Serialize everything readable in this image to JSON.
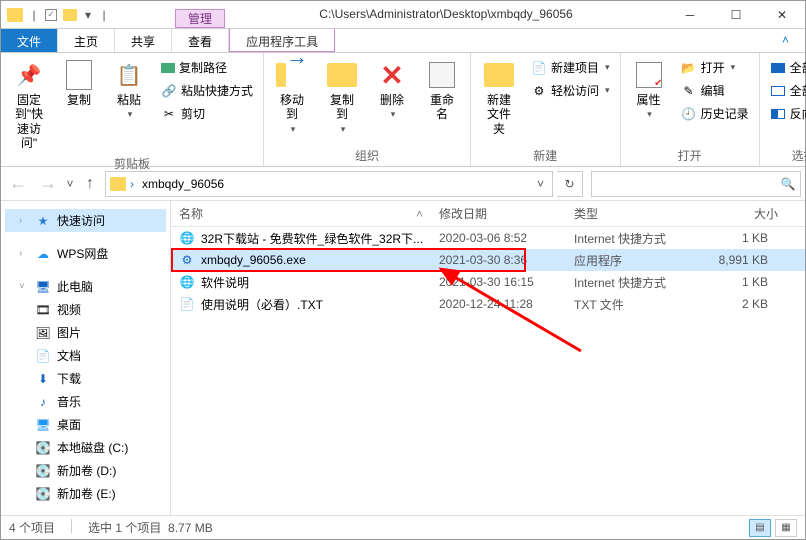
{
  "titlebar": {
    "manage_label": "管理",
    "path": "C:\\Users\\Administrator\\Desktop\\xmbqdy_96056"
  },
  "tabs": {
    "file": "文件",
    "home": "主页",
    "share": "共享",
    "view": "查看",
    "apptools": "应用程序工具"
  },
  "ribbon": {
    "pin": "固定到\"快速访问\"",
    "copy": "复制",
    "paste": "粘贴",
    "copy_path": "复制路径",
    "paste_shortcut": "粘贴快捷方式",
    "cut": "剪切",
    "group_clip": "剪贴板",
    "move_to": "移动到",
    "copy_to": "复制到",
    "delete": "删除",
    "rename": "重命名",
    "group_org": "组织",
    "new_folder": "新建文件夹",
    "new_item": "新建项目",
    "easy_access": "轻松访问",
    "group_new": "新建",
    "properties": "属性",
    "open": "打开",
    "edit": "编辑",
    "history": "历史记录",
    "group_open": "打开",
    "select_all": "全部选择",
    "select_none": "全部取消",
    "invert": "反向选择",
    "group_select": "选择"
  },
  "address": {
    "crumb": "xmbqdy_96056"
  },
  "search": {
    "placeholder": ""
  },
  "nav": {
    "quick": "快速访问",
    "wps": "WPS网盘",
    "pc": "此电脑",
    "video": "视频",
    "pic": "图片",
    "doc": "文档",
    "dl": "下载",
    "music": "音乐",
    "desktop": "桌面",
    "c": "本地磁盘 (C:)",
    "d": "新加卷 (D:)",
    "e": "新加卷 (E:)"
  },
  "cols": {
    "name": "名称",
    "date": "修改日期",
    "type": "类型",
    "size": "大小"
  },
  "files": [
    {
      "name": "32R下载站 - 免费软件_绿色软件_32R下...",
      "date": "2020-03-06 8:52",
      "type": "Internet 快捷方式",
      "size": "1 KB",
      "icon": "url"
    },
    {
      "name": "xmbqdy_96056.exe",
      "date": "2021-03-30 8:36",
      "type": "应用程序",
      "size": "8,991 KB",
      "icon": "exe",
      "selected": true
    },
    {
      "name": "软件说明",
      "date": "2021-03-30 16:15",
      "type": "Internet 快捷方式",
      "size": "1 KB",
      "icon": "url"
    },
    {
      "name": "使用说明（必看）.TXT",
      "date": "2020-12-24 11:28",
      "type": "TXT 文件",
      "size": "2 KB",
      "icon": "txt"
    }
  ],
  "status": {
    "count": "4 个项目",
    "selected": "选中 1 个项目",
    "size": "8.77 MB"
  }
}
